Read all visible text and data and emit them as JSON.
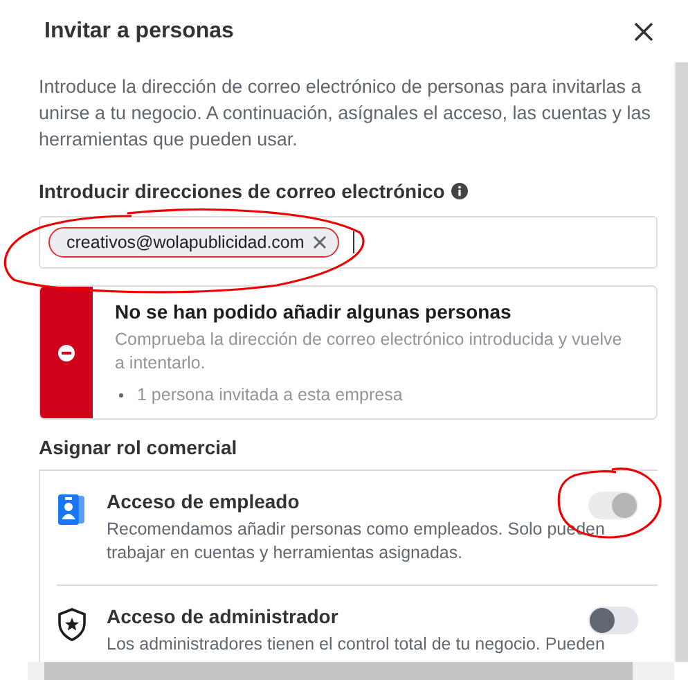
{
  "dialog": {
    "title": "Invitar a personas",
    "intro": "Introduce la dirección de correo electrónico de personas para invitarlas a unirse a tu negocio. A continuación, asígnales el acceso, las cuentas y las herramientas que pueden usar.",
    "email_label": "Introducir direcciones de correo electrónico",
    "email_field": {
      "chips": [
        {
          "label": "creativos@wolapublicidad.com"
        }
      ]
    },
    "error": {
      "title": "No se han podido añadir algunas personas",
      "message": "Comprueba la dirección de correo electrónico introducida y vuelve a intentarlo.",
      "bullets": [
        "1 persona invitada a esta empresa"
      ]
    },
    "role_section": {
      "title": "Asignar rol comercial",
      "roles": [
        {
          "kind": "employee",
          "title": "Acceso de empleado",
          "description": "Recomendamos añadir personas como empleados. Solo pueden trabajar en cuentas y herramientas asignadas.",
          "on": true,
          "disabled": true
        },
        {
          "kind": "admin",
          "title": "Acceso de administrador",
          "description": "Los administradores tienen el control total de tu negocio. Pueden",
          "on": false,
          "disabled": false
        }
      ]
    }
  }
}
